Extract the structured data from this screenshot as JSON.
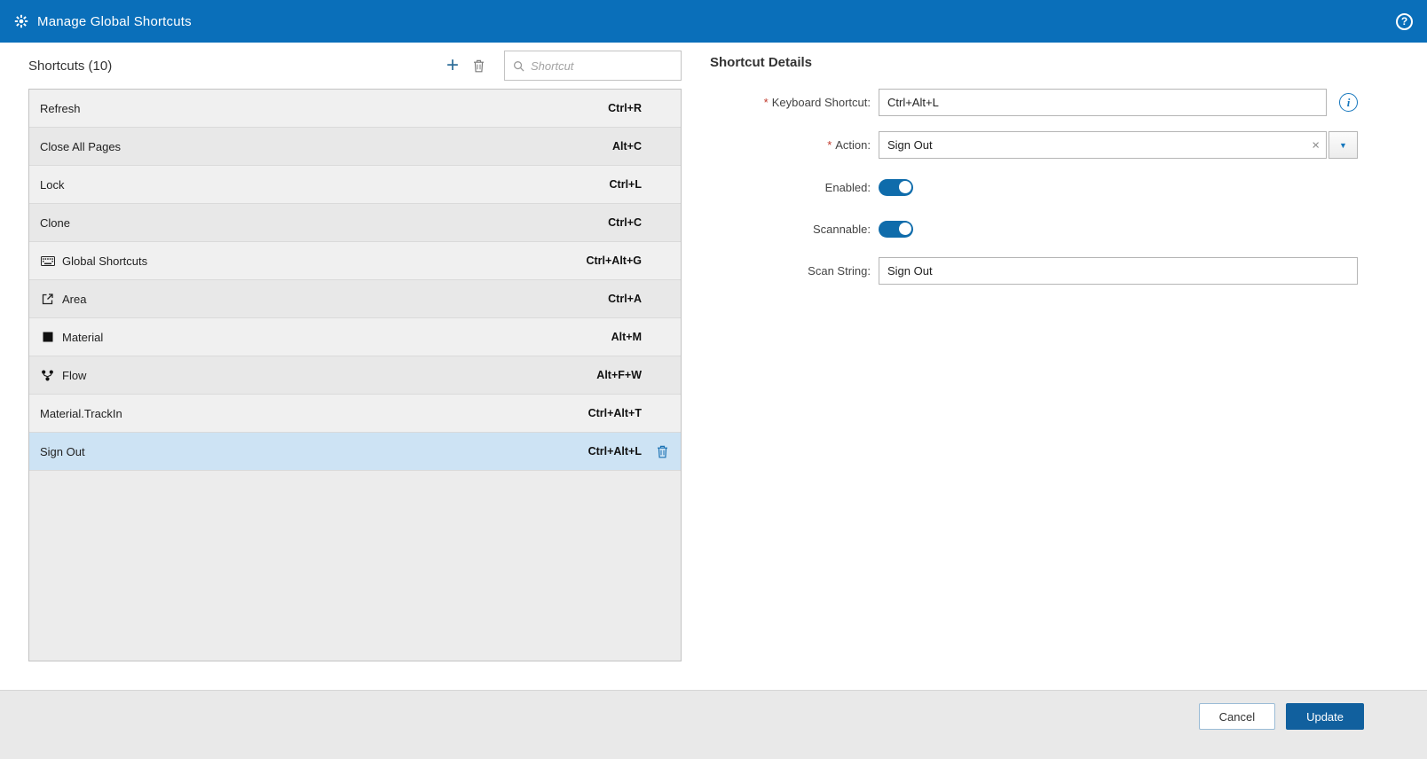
{
  "titlebar": {
    "title": "Manage Global Shortcuts"
  },
  "icons": {
    "add": "+",
    "help": "?",
    "clear": "×",
    "dropdown": "▼",
    "info": "i"
  },
  "shortcuts_panel": {
    "title": "Shortcuts (10)",
    "search_placeholder": "Shortcut",
    "rows": [
      {
        "label": "Refresh",
        "keys": "Ctrl+R"
      },
      {
        "label": "Close All Pages",
        "keys": "Alt+C"
      },
      {
        "label": "Lock",
        "keys": "Ctrl+L"
      },
      {
        "label": "Clone",
        "keys": "Ctrl+C"
      },
      {
        "label": "Global Shortcuts",
        "keys": "Ctrl+Alt+G",
        "icon": "keyboard-icon"
      },
      {
        "label": "Area",
        "keys": "Ctrl+A",
        "icon": "area-icon"
      },
      {
        "label": "Material",
        "keys": "Alt+M",
        "icon": "material-icon"
      },
      {
        "label": "Flow",
        "keys": "Alt+F+W",
        "icon": "flow-icon"
      },
      {
        "label": "Material.TrackIn",
        "keys": "Ctrl+Alt+T"
      },
      {
        "label": "Sign Out",
        "keys": "Ctrl+Alt+L",
        "selected": true
      }
    ]
  },
  "details_panel": {
    "title": "Shortcut Details",
    "keyboard_shortcut": {
      "label": "Keyboard Shortcut:",
      "required": "*",
      "value": "Ctrl+Alt+L"
    },
    "action": {
      "label": "Action:",
      "required": "*",
      "value": "Sign Out"
    },
    "enabled": {
      "label": "Enabled:",
      "state": "on"
    },
    "scannable": {
      "label": "Scannable:",
      "state": "on"
    },
    "scan_string": {
      "label": "Scan String:",
      "value": "Sign Out"
    }
  },
  "footer": {
    "cancel_label": "Cancel",
    "update_label": "Update"
  },
  "colors": {
    "header_bg": "#0a6fba",
    "selected_row_bg": "#cde3f4",
    "accent_blue": "#1677bd",
    "toggle_on": "#0f6cab",
    "update_button_bg": "#11609e",
    "required_red": "#c0392b"
  }
}
